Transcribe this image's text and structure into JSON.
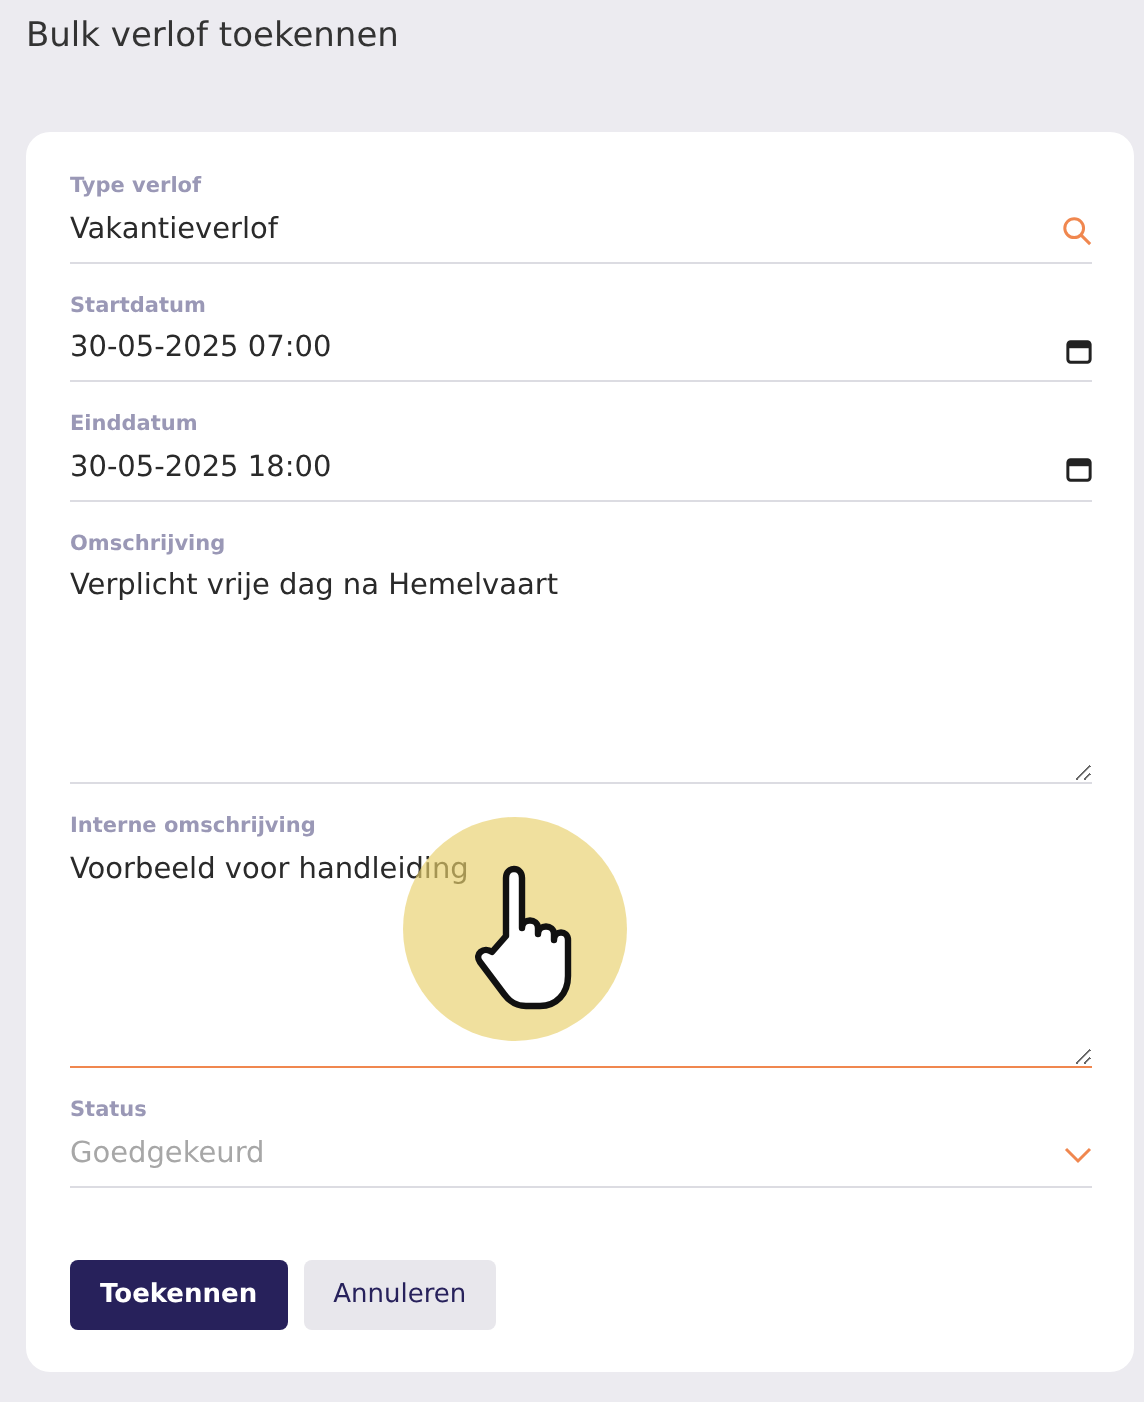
{
  "title": "Bulk verlof toekennen",
  "fields": [
    {
      "kind": "search",
      "label": "Type verlof",
      "value": "Vakantieverlof",
      "focused": false,
      "disabled": false
    },
    {
      "kind": "datetime",
      "label": "Startdatum",
      "value": "30-05-2025 07:00",
      "focused": false,
      "disabled": false
    },
    {
      "kind": "datetime",
      "label": "Einddatum",
      "value": "30-05-2025 18:00",
      "focused": false,
      "disabled": false
    },
    {
      "kind": "textarea",
      "label": "Omschrijving",
      "value": "Verplicht vrije dag na Hemelvaart",
      "focused": false,
      "disabled": false
    },
    {
      "kind": "textarea",
      "label": "Interne omschrijving",
      "value": "Voorbeeld voor handleiding",
      "focused": true,
      "disabled": false
    },
    {
      "kind": "select",
      "label": "Status",
      "value": "Goedgekeurd",
      "focused": false,
      "disabled": true
    }
  ],
  "buttons": [
    {
      "kind": "primary",
      "label": "Toekennen"
    },
    {
      "kind": "secondary",
      "label": "Annuleren"
    }
  ],
  "cursor": {
    "kind": "hand"
  }
}
